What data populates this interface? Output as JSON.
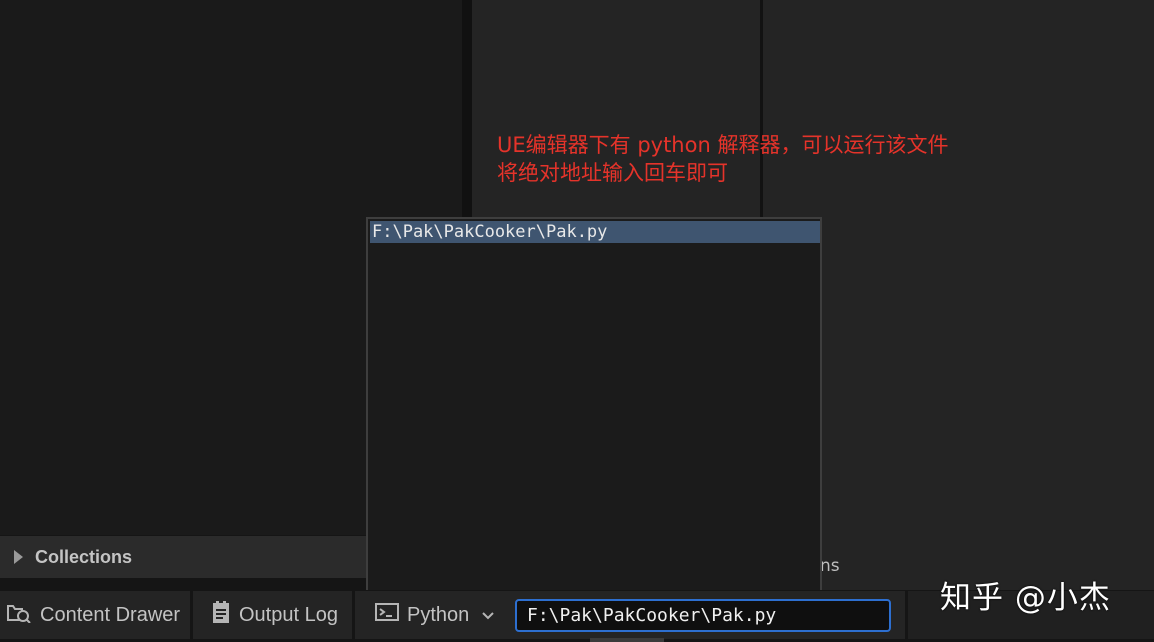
{
  "annotation": {
    "line1": "UE编辑器下有 python 解释器，可以运行该文件",
    "line2": "将绝对地址输入回车即可"
  },
  "popup": {
    "items": [
      "F:\\Pak\\PakCooker\\Pak.py"
    ]
  },
  "collections": {
    "label": "Collections"
  },
  "right_panel": {
    "partial_text": "ns"
  },
  "bottombar": {
    "content_drawer": "Content Drawer",
    "output_log": "Output Log",
    "python_mode": "Python",
    "command_value": "F:\\Pak\\PakCooker\\Pak.py"
  },
  "watermark": "知乎 @小杰",
  "colors": {
    "annotation": "#e5332a",
    "selection": "#3f5570",
    "input_focus": "#2d6fd0"
  },
  "icons": {
    "content_drawer": "content-drawer-icon",
    "output_log": "output-log-icon",
    "python": "console-icon",
    "dropdown": "chevron-down-icon",
    "collections": "triangle-right-icon"
  }
}
